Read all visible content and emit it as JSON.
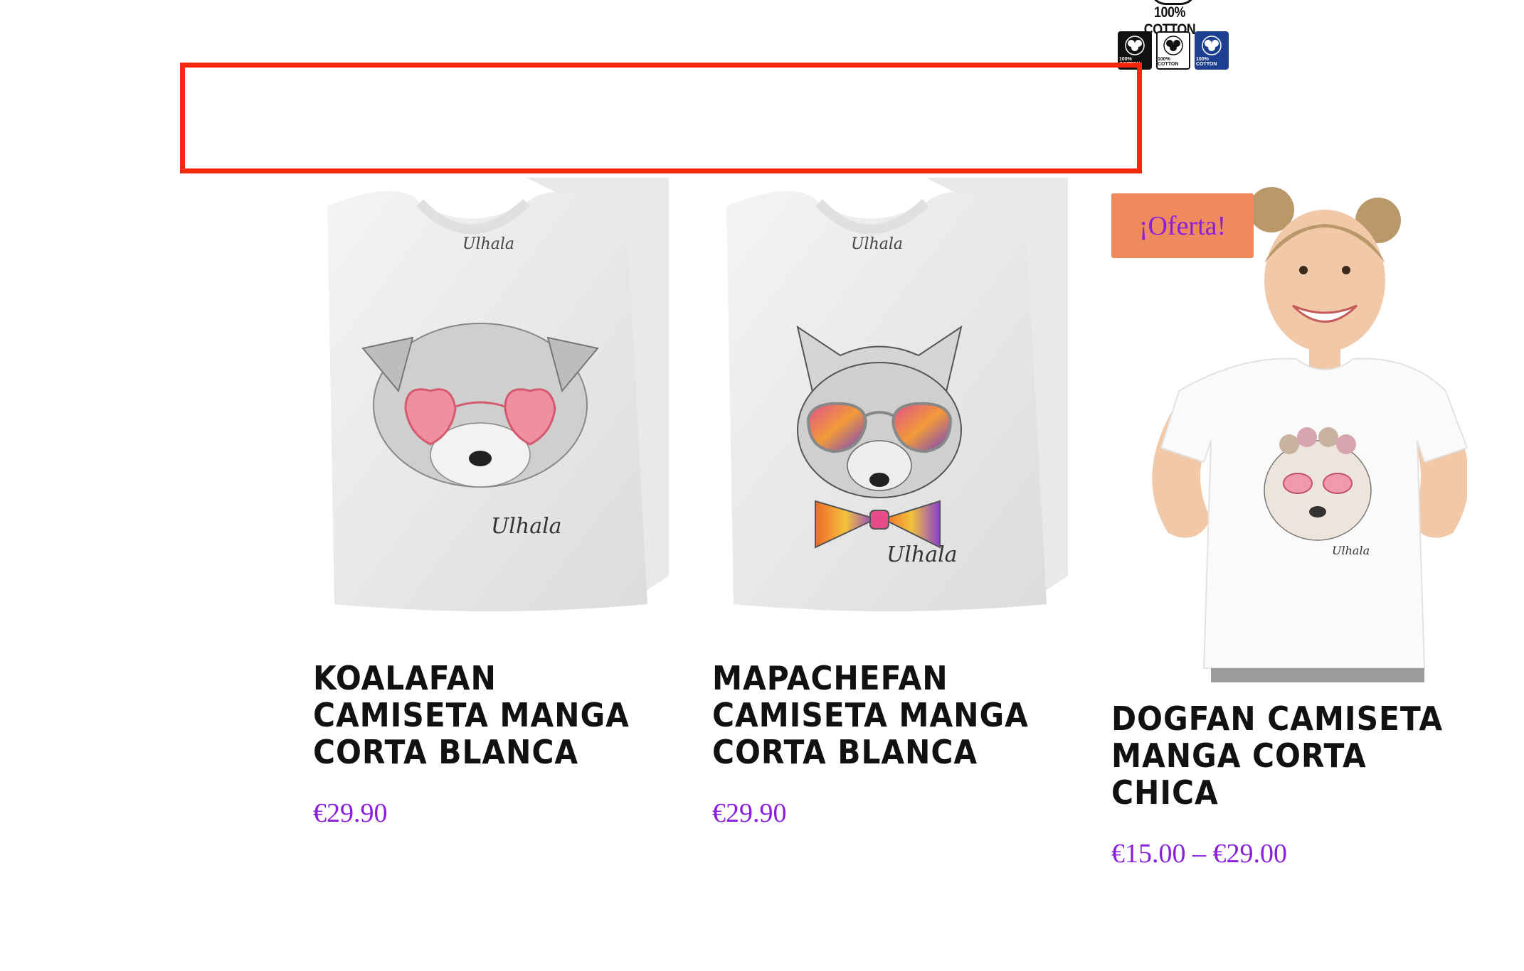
{
  "brand_badge": {
    "text": "100% COTTON",
    "mini_labels": [
      "100% COTTON",
      "100% COTTON",
      "100% COTTON"
    ]
  },
  "products": [
    {
      "title": "Koalafan Camiseta Manga Corta Blanca",
      "price": "€29.90",
      "shirt_signature": "Ulhala",
      "collar_label": "Ulhala"
    },
    {
      "title": "Mapachefan Camiseta Manga Corta Blanca",
      "price": "€29.90",
      "shirt_signature": "Ulhala",
      "collar_label": "Ulhala"
    },
    {
      "title": "Dogfan Camiseta Manga Corta Chica",
      "price": "€15.00 – €29.00",
      "sale_badge": "¡Oferta!",
      "shirt_signature": "Ulhala"
    }
  ],
  "colors": {
    "price": "#8a1fdc",
    "sale_badge_bg": "#ef8a5e",
    "highlight_border": "#f5290d"
  }
}
